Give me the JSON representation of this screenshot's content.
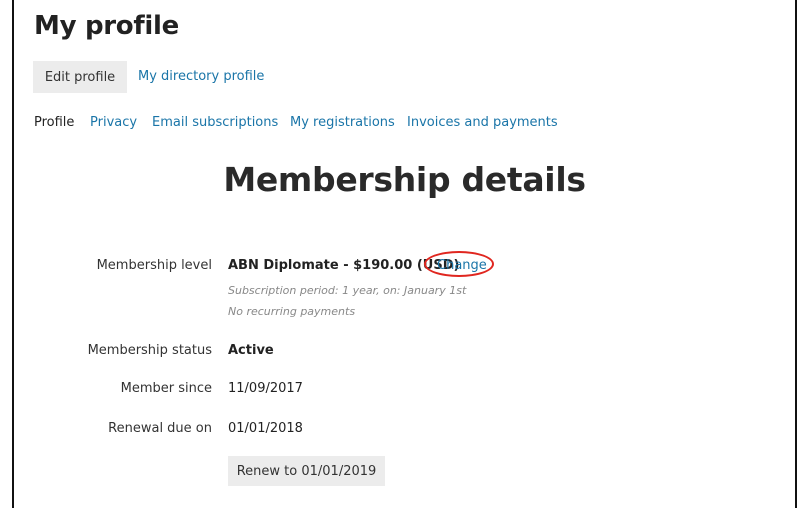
{
  "header": {
    "title": "My profile"
  },
  "profile_actions": {
    "edit_label": "Edit profile",
    "directory_label": "My directory profile"
  },
  "tabs": [
    {
      "label": "Profile",
      "active": true
    },
    {
      "label": "Privacy",
      "active": false
    },
    {
      "label": "Email subscriptions",
      "active": false
    },
    {
      "label": "My registrations",
      "active": false
    },
    {
      "label": "Invoices and payments",
      "active": false
    }
  ],
  "membership": {
    "title": "Membership details",
    "level_label": "Membership level",
    "level_value": "ABN Diplomate - $190.00 (USD)",
    "change_label": "Change",
    "subscription_note": "Subscription period: 1 year, on: January 1st",
    "recurring_note": "No recurring payments",
    "status_label": "Membership status",
    "status_value": "Active",
    "since_label": "Member since",
    "since_value": "11/09/2017",
    "renewal_label": "Renewal due on",
    "renewal_value": "01/01/2018",
    "renew_button_label": "Renew to 01/01/2019"
  },
  "colors": {
    "link": "#1a75a8",
    "highlight_circle": "#e0261f",
    "button_bg": "#ececec"
  }
}
